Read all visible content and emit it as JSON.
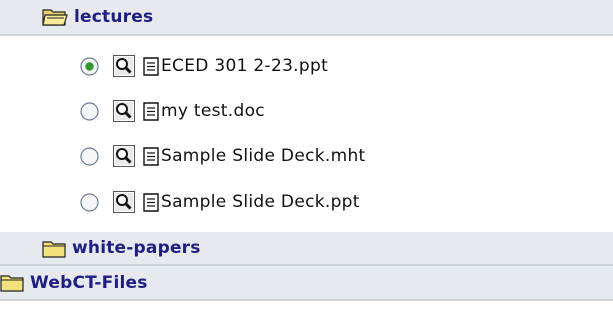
{
  "tree": {
    "folders": [
      {
        "name": "lectures",
        "state": "open",
        "files": [
          {
            "name": "ECED 301 2-23.ppt",
            "selected": true
          },
          {
            "name": "my test.doc",
            "selected": false
          },
          {
            "name": "Sample Slide Deck.mht",
            "selected": false
          },
          {
            "name": "Sample Slide Deck.ppt",
            "selected": false
          }
        ]
      },
      {
        "name": "white-papers",
        "state": "closed"
      },
      {
        "name": "WebCT-Files",
        "state": "closed"
      }
    ]
  },
  "colors": {
    "folder_label": "#1e1e86",
    "folder_row_bg": "#e6e9ee",
    "folder_icon": "#f0e07a",
    "radio_selected": "#2e8b2e"
  },
  "icons": {
    "open_folder": "open-folder-icon",
    "closed_folder": "folder-icon",
    "preview": "magnifier-icon",
    "document": "document-icon",
    "radio": "radio-button"
  }
}
